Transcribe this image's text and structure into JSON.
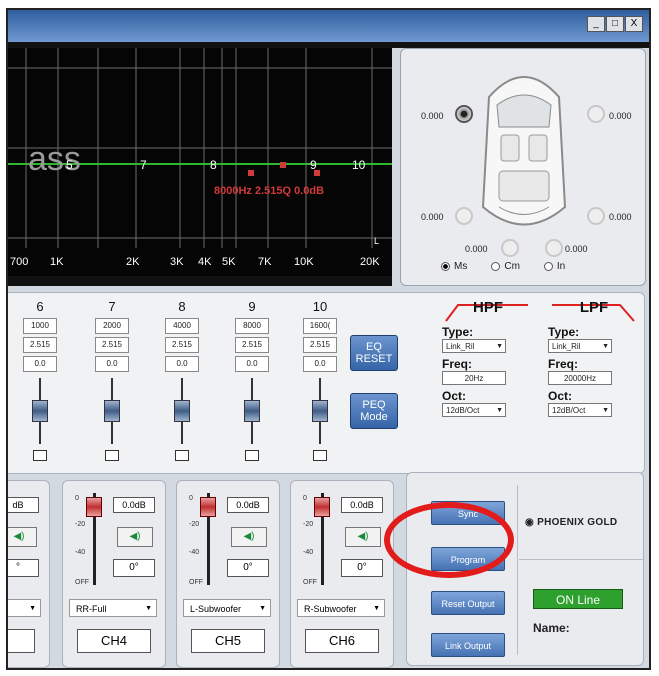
{
  "window": {
    "buttons": [
      "_",
      "□",
      "X"
    ]
  },
  "graph": {
    "overlay_text": "ass",
    "band_markers": [
      "5",
      "7",
      "8",
      "9",
      "10"
    ],
    "point_label": "8000Hz 2.515Q 0.0dB",
    "x_ticks": [
      "700",
      "1K",
      "2K",
      "3K",
      "4K",
      "5K",
      "7K",
      "10K",
      "20K"
    ],
    "corner_label": "L",
    "colors": {
      "curve": "#2fb82f",
      "point": "#d23a3a",
      "grid": "#7a7a7a"
    }
  },
  "speakers": {
    "values": [
      "0.000",
      "0.000",
      "0.000",
      "0.000",
      "0.000",
      "0.000"
    ],
    "units": [
      "Ms",
      "Cm",
      "In"
    ],
    "selected_unit": "Ms"
  },
  "eq": {
    "bands": [
      {
        "num": "6",
        "freq": "1000",
        "q": "2.515",
        "gain": "0.0"
      },
      {
        "num": "7",
        "freq": "2000",
        "q": "2.515",
        "gain": "0.0"
      },
      {
        "num": "8",
        "freq": "4000",
        "q": "2.515",
        "gain": "0.0"
      },
      {
        "num": "9",
        "freq": "8000",
        "q": "2.515",
        "gain": "0.0"
      },
      {
        "num": "10",
        "freq": "1600(",
        "q": "2.515",
        "gain": "0.0"
      }
    ],
    "reset_label": "EQ RESET",
    "peq_label": "PEQ Mode"
  },
  "hpf": {
    "title": "HPF",
    "type_label": "Type:",
    "type": "Link_Ril",
    "freq_label": "Freq:",
    "freq": "20Hz",
    "oct_label": "Oct:",
    "oct": "12dB/Oct"
  },
  "lpf": {
    "title": "LPF",
    "type_label": "Type:",
    "type": "Link_Ril",
    "freq_label": "Freq:",
    "freq": "20000Hz",
    "oct_label": "Oct:",
    "oct": "12dB/Oct"
  },
  "channels": {
    "partial_db": "dB",
    "partial_phase": "°",
    "scale": [
      "0",
      "-20",
      "-40",
      "OFF"
    ],
    "strips": [
      {
        "db": "0.0dB",
        "phase": "0°",
        "speaker": "RR-Full",
        "name": "CH4"
      },
      {
        "db": "0.0dB",
        "phase": "0°",
        "speaker": "L-Subwoofer",
        "name": "CH5"
      },
      {
        "db": "0.0dB",
        "phase": "0°",
        "speaker": "R-Subwoofer",
        "name": "CH6"
      }
    ]
  },
  "program": {
    "top_button": "Sync",
    "program_button": "Program",
    "reset_button": "Reset Output",
    "link_button": "Link Output",
    "logo": "PHOENIX GOLD",
    "status": "ON Line",
    "name_label": "Name:"
  }
}
